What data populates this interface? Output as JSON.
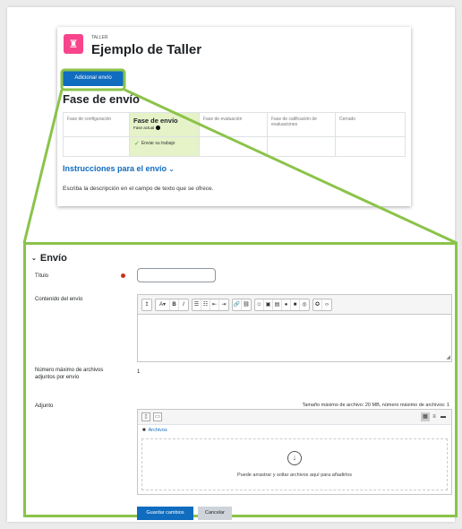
{
  "workshop": {
    "module_type": "TALLER",
    "title": "Ejemplo de Taller",
    "add_button": "Adicionar envío",
    "phase_heading": "Fase de envío",
    "phases": [
      {
        "name": "Fase de configuración"
      },
      {
        "name": "Fase de envío",
        "current_label": "Fase actual",
        "task": "Enviar su trabajo"
      },
      {
        "name": "Fase de evaluación"
      },
      {
        "name": "Fase de calificación de evaluaciones"
      },
      {
        "name": "Cerrado"
      }
    ],
    "instructions_heading": "Instrucciones para el envío",
    "instructions_text": "Escriba la descripción en el campo de texto que se ofrece."
  },
  "form": {
    "section_title": "Envío",
    "title_label": "Título",
    "content_label": "Contenido del envío",
    "max_files_label": "Número máximo de archivos adjuntos por envío",
    "max_files_value": "1",
    "attachment_label": "Adjunto",
    "limits_text": "Tamaño máximo de archivo: 20 MB, número máximo de archivos: 1",
    "files_folder": "Archivos",
    "drop_text": "Puede arrastrar y soltar archivos aquí para añadirlos",
    "save_button": "Guardar cambios",
    "cancel_button": "Cancelar"
  },
  "colors": {
    "accent": "#0f6cbf",
    "callout": "#8bc34a",
    "current_phase": "#e6f2c8",
    "module_icon": "#f7458b"
  }
}
